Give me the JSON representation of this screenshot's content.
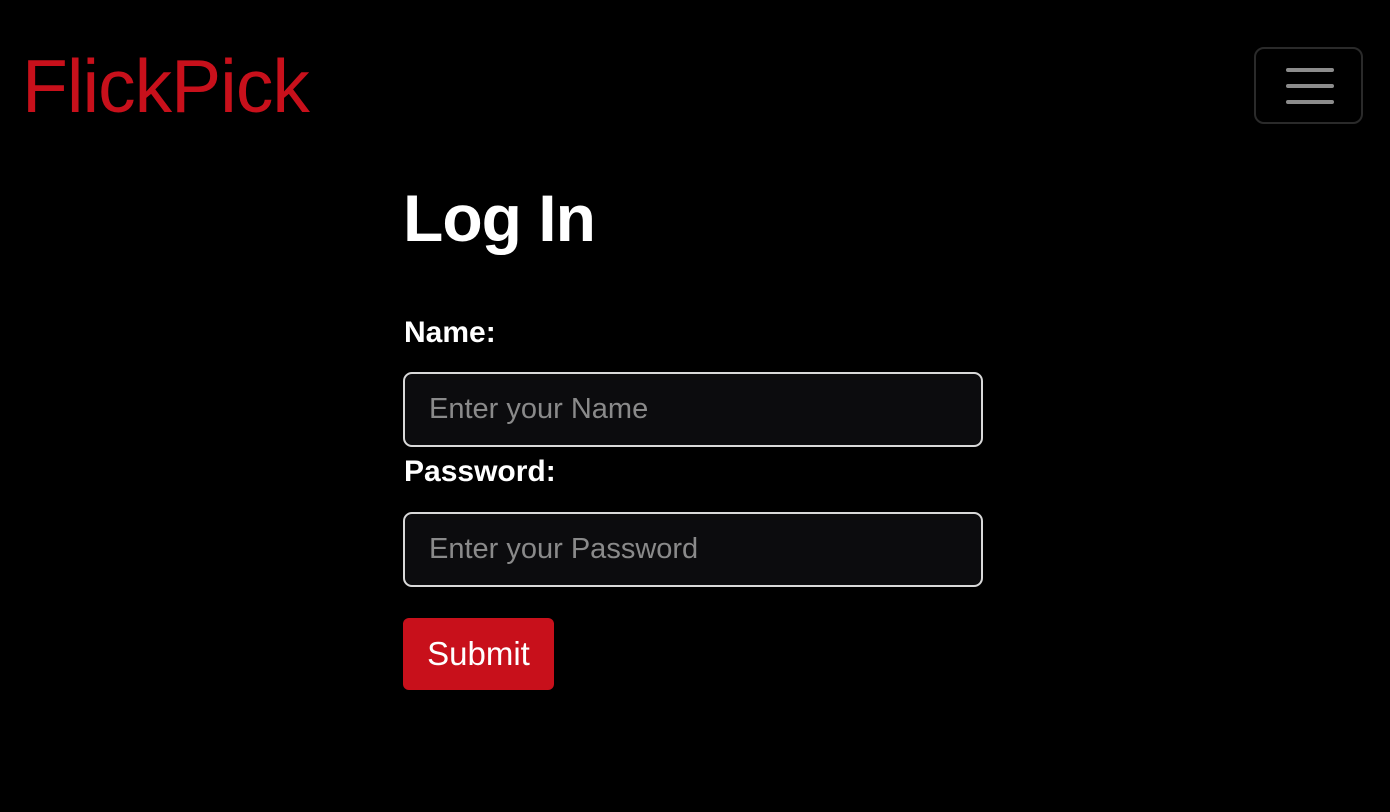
{
  "navbar": {
    "brand": "FlickPick",
    "menu_icon": "hamburger-menu-icon"
  },
  "form": {
    "title": "Log In",
    "name_label": "Name:",
    "name_placeholder": "Enter your Name",
    "name_value": "",
    "password_label": "Password:",
    "password_placeholder": "Enter your Password",
    "password_value": "",
    "submit_label": "Submit"
  },
  "colors": {
    "background": "#000000",
    "brand": "#c8101b",
    "button": "#c8101b",
    "text": "#ffffff"
  }
}
